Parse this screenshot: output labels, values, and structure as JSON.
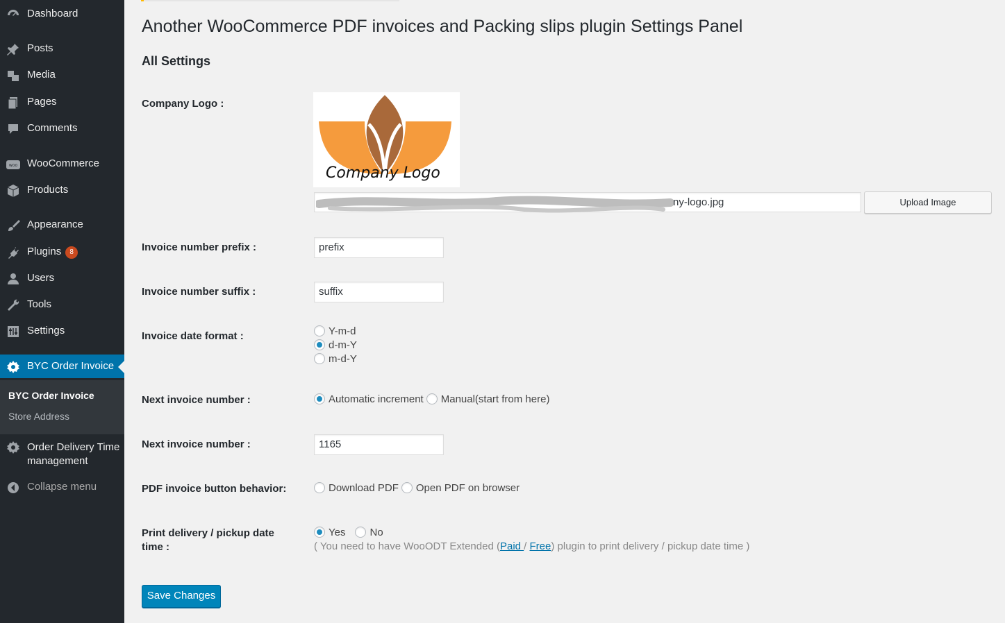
{
  "sidebar": {
    "items": [
      {
        "label": "Dashboard",
        "icon": "dashboard-icon"
      },
      {
        "label": "Posts",
        "icon": "pin-icon"
      },
      {
        "label": "Media",
        "icon": "media-icon"
      },
      {
        "label": "Pages",
        "icon": "pages-icon"
      },
      {
        "label": "Comments",
        "icon": "comment-icon"
      },
      {
        "label": "WooCommerce",
        "icon": "woo-icon"
      },
      {
        "label": "Products",
        "icon": "box-icon"
      },
      {
        "label": "Appearance",
        "icon": "brush-icon"
      },
      {
        "label": "Plugins",
        "icon": "plug-icon",
        "badge": "8"
      },
      {
        "label": "Users",
        "icon": "user-icon"
      },
      {
        "label": "Tools",
        "icon": "wrench-icon"
      },
      {
        "label": "Settings",
        "icon": "sliders-icon"
      },
      {
        "label": "BYC Order Invoice",
        "icon": "gear-icon",
        "active": true
      },
      {
        "label": "Order Delivery Time management",
        "icon": "gear-icon"
      },
      {
        "label": "Collapse menu",
        "icon": "collapse-icon"
      }
    ],
    "submenu": [
      {
        "label": "BYC Order Invoice",
        "current": true
      },
      {
        "label": "Store Address"
      }
    ]
  },
  "page": {
    "title": "Another WooCommerce PDF invoices and Packing slips plugin Settings Panel",
    "section_title": "All Settings"
  },
  "settings": {
    "company_logo": {
      "label": "Company Logo :",
      "logo_text": "Company Logo",
      "file_value": "ny-logo.jpg",
      "upload_button": "Upload Image"
    },
    "invoice_prefix": {
      "label": "Invoice number prefix :",
      "value": "prefix"
    },
    "invoice_suffix": {
      "label": "Invoice number suffix :",
      "value": "suffix"
    },
    "date_format": {
      "label": "Invoice date format :",
      "options": [
        "Y-m-d",
        "d-m-Y",
        "m-d-Y"
      ],
      "selected": "d-m-Y"
    },
    "next_number_mode": {
      "label": "Next invoice number :",
      "options": [
        "Automatic increment",
        "Manual(start from here)"
      ],
      "selected": "Automatic increment"
    },
    "next_number": {
      "label": "Next invoice number :",
      "value": "1165"
    },
    "pdf_behavior": {
      "label": "PDF invoice button behavior:",
      "options": [
        "Download PDF",
        "Open PDF on browser"
      ],
      "selected": ""
    },
    "print_delivery": {
      "label_line1": "Print delivery / pickup date",
      "label_line2": "time :",
      "options": [
        "Yes",
        "No"
      ],
      "selected": "Yes",
      "note_prefix": "( You need to have WooODT Extended (",
      "link_paid": "Paid ",
      "note_sep": "/ ",
      "link_free": "Free",
      "note_suffix": ") plugin to print delivery / pickup date time )"
    }
  },
  "save_button": "Save Changes",
  "colors": {
    "sidebar_bg": "#23282d",
    "active_bg": "#0073aa",
    "primary_button": "#0085ba",
    "badge": "#ca4a1f",
    "logo_orange": "#f59b3d",
    "logo_brown": "#a9693a"
  }
}
